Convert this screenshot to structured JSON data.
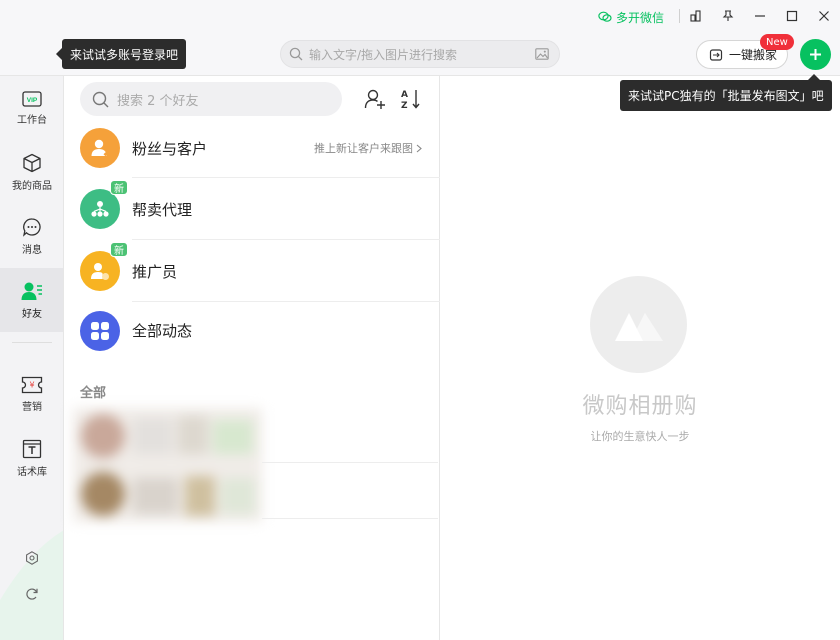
{
  "titlebar": {
    "multi_wechat_label": "多开微信"
  },
  "search": {
    "placeholder": "输入文字/拖入图片进行搜索"
  },
  "tooltips": {
    "multi_account": "来试试多账号登录吧",
    "batch_publish": "来试试PC独有的「批量发布图文」吧"
  },
  "actions": {
    "one_key_move_label": "一键搬家",
    "new_badge": "New"
  },
  "sidebar": {
    "items": [
      {
        "label": "工作台",
        "icon": "vip-workbench-icon",
        "active": false
      },
      {
        "label": "我的商品",
        "icon": "product-box-icon",
        "active": false
      },
      {
        "label": "消息",
        "icon": "message-bubble-icon",
        "active": false
      },
      {
        "label": "好友",
        "icon": "friends-icon",
        "active": true
      },
      {
        "label": "营销",
        "icon": "marketing-ticket-icon",
        "active": false
      },
      {
        "label": "话术库",
        "icon": "script-library-icon",
        "active": false
      }
    ]
  },
  "friends": {
    "search_placeholder": "搜索 2 个好友",
    "entries": [
      {
        "label": "粉丝与客户",
        "color": "#f5a13a",
        "badge": "",
        "right_text": "推上新让客户来跟图"
      },
      {
        "label": "帮卖代理",
        "color": "#3dbd84",
        "badge": "新",
        "right_text": ""
      },
      {
        "label": "推广员",
        "color": "#f7b322",
        "badge": "新",
        "right_text": ""
      },
      {
        "label": "全部动态",
        "color": "#4b63e6",
        "badge": "",
        "right_text": ""
      }
    ],
    "section_all": "全部"
  },
  "empty_state": {
    "title": "微购相册购",
    "subtitle": "让你的生意快人一步"
  },
  "colors": {
    "accent": "#07c160",
    "badge_red": "#f0303a"
  }
}
